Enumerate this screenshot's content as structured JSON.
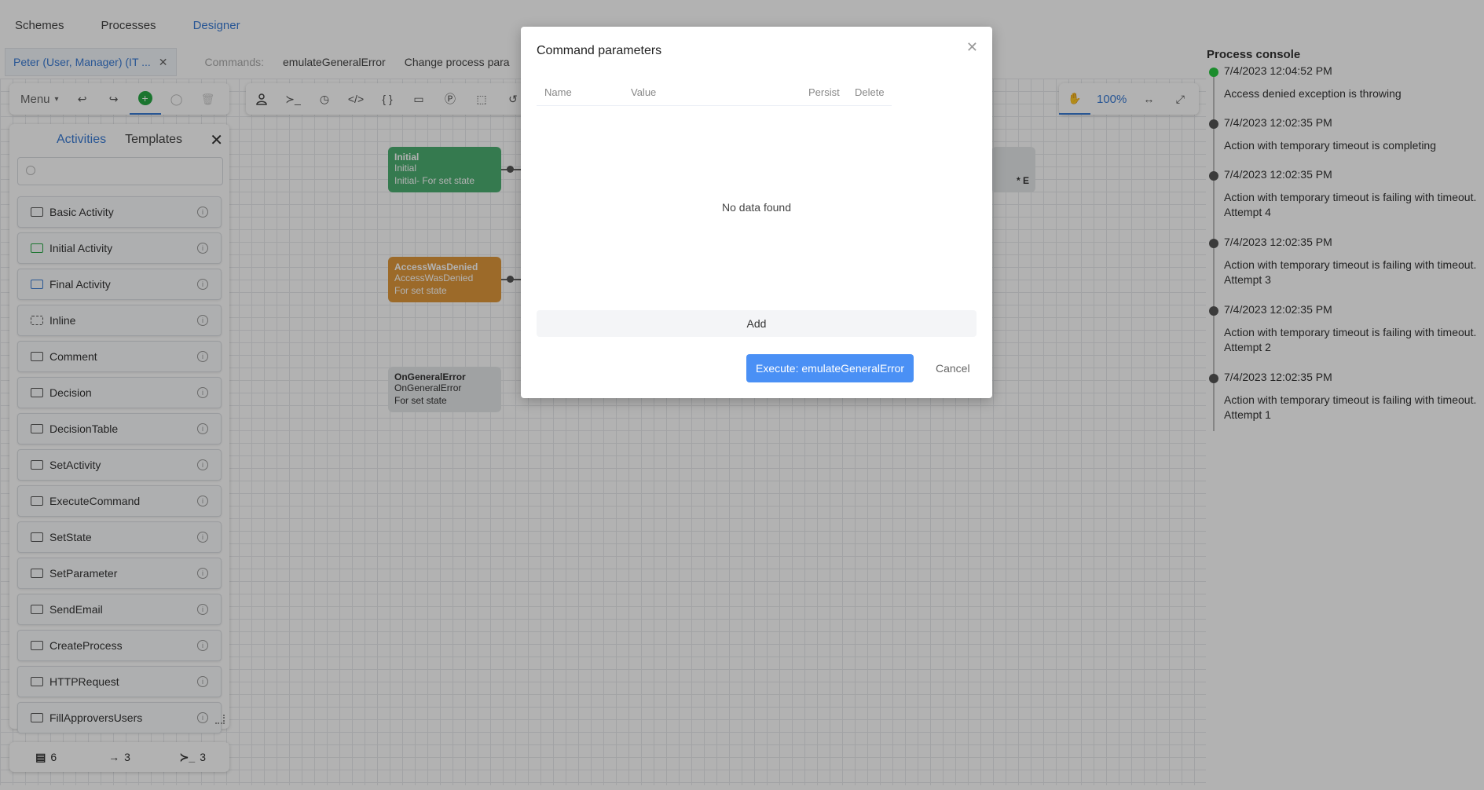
{
  "topnav": {
    "items": [
      "Schemes",
      "Processes",
      "Designer"
    ],
    "active": "Designer"
  },
  "tabs": {
    "process_tab": "Peter (User, Manager) (IT ...",
    "commands_label": "Commands:",
    "commands": [
      "emulateGeneralError",
      "Change process para"
    ]
  },
  "toolbar": {
    "menu_label": "Menu",
    "zoom": "100%"
  },
  "left_panel": {
    "tabs": [
      "Activities",
      "Templates"
    ],
    "search_placeholder": "",
    "activities": [
      "Basic Activity",
      "Initial Activity",
      "Final Activity",
      "Inline",
      "Comment",
      "Decision",
      "DecisionTable",
      "SetActivity",
      "ExecuteCommand",
      "SetState",
      "SetParameter",
      "SendEmail",
      "CreateProcess",
      "HTTPRequest",
      "FillApproversUsers"
    ]
  },
  "stats": {
    "activities": "6",
    "transitions": "3",
    "commands": "3"
  },
  "nodes": [
    {
      "title": "Initial",
      "subtitle": "Initial",
      "state": "Initial- For set state"
    },
    {
      "title": "AccessWasDenied",
      "subtitle": "AccessWasDenied",
      "state": "For set state"
    },
    {
      "title": "OnGeneralError",
      "subtitle": "OnGeneralError",
      "state": "For set state"
    }
  ],
  "partial_node_text": "* E",
  "console": {
    "title": "Process console",
    "entries": [
      {
        "time": "7/4/2023 12:04:52 PM",
        "message": "Access denied exception is throwing"
      },
      {
        "time": "7/4/2023 12:02:35 PM",
        "message": "Action with temporary timeout is completing"
      },
      {
        "time": "7/4/2023 12:02:35 PM",
        "message": "Action with temporary timeout is failing with timeout. Attempt 4"
      },
      {
        "time": "7/4/2023 12:02:35 PM",
        "message": "Action with temporary timeout is failing with timeout. Attempt 3"
      },
      {
        "time": "7/4/2023 12:02:35 PM",
        "message": "Action with temporary timeout is failing with timeout. Attempt 2"
      },
      {
        "time": "7/4/2023 12:02:35 PM",
        "message": "Action with temporary timeout is failing with timeout. Attempt 1"
      }
    ]
  },
  "modal": {
    "title": "Command parameters",
    "columns": [
      "Name",
      "Value",
      "Persist",
      "Delete"
    ],
    "empty_text": "No data found",
    "add_label": "Add",
    "execute_label": "Execute: emulateGeneralError",
    "cancel_label": "Cancel"
  },
  "colors": {
    "accent": "#3a7bd5",
    "initial_node": "#4caf72",
    "denied_node": "#e0993b",
    "execute_button": "#4a90f5",
    "console_active_dot": "#27c93f"
  }
}
